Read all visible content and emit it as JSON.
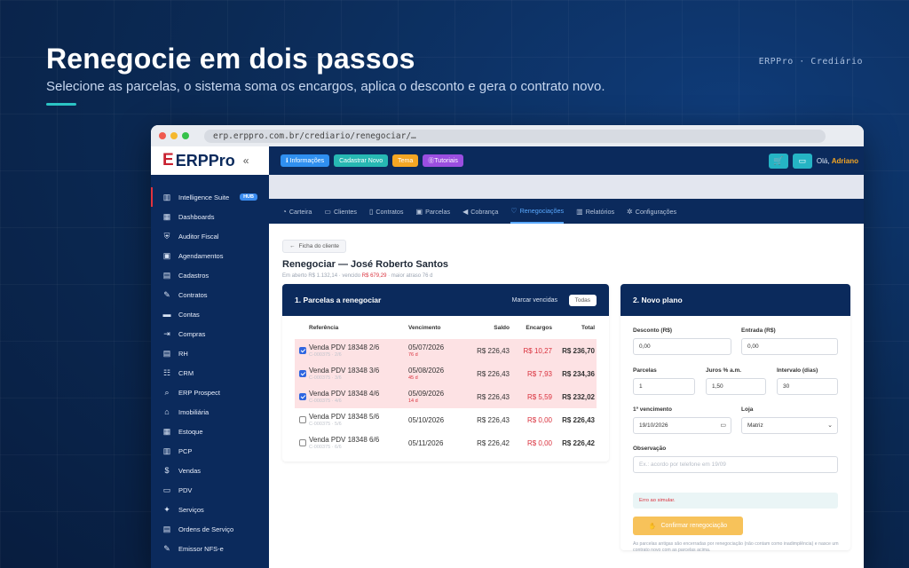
{
  "hero": {
    "title": "Renegocie em dois passos",
    "subtitle": "Selecione as parcelas, o sistema soma os encargos, aplica o desconto e gera o contrato novo.",
    "brand_tag": "ERPPro · Crediário"
  },
  "browser": {
    "url": "erp.erppro.com.br/crediario/renegociar/…"
  },
  "logo": {
    "mark": "E",
    "text": "ERPPro",
    "collapse_icon": "chevrons-left-icon"
  },
  "sidebar": {
    "items": [
      {
        "label": "Intelligence Suite",
        "icon": "chart-icon",
        "badge": "HUB"
      },
      {
        "label": "Dashboards",
        "icon": "dashboard-icon"
      },
      {
        "label": "Auditor Fiscal",
        "icon": "shield-icon"
      },
      {
        "label": "Agendamentos",
        "icon": "calendar-icon"
      },
      {
        "label": "Cadastros",
        "icon": "folder-icon"
      },
      {
        "label": "Contratos",
        "icon": "pen-icon"
      },
      {
        "label": "Contas",
        "icon": "wallet-icon"
      },
      {
        "label": "Compras",
        "icon": "login-icon"
      },
      {
        "label": "RH",
        "icon": "id-card-icon"
      },
      {
        "label": "CRM",
        "icon": "users-icon"
      },
      {
        "label": "ERP Prospect",
        "icon": "search-icon"
      },
      {
        "label": "Imobiliária",
        "icon": "home-icon"
      },
      {
        "label": "Estoque",
        "icon": "box-icon"
      },
      {
        "label": "PCP",
        "icon": "factory-icon"
      },
      {
        "label": "Vendas",
        "icon": "dollar-icon"
      },
      {
        "label": "PDV",
        "icon": "monitor-icon"
      },
      {
        "label": "Serviços",
        "icon": "wrench-icon"
      },
      {
        "label": "Ordens de Serviço",
        "icon": "clipboard-icon"
      },
      {
        "label": "Emissor NFS-e",
        "icon": "receipt-icon"
      }
    ]
  },
  "topbar": {
    "buttons": [
      {
        "label": "ℹ Informações",
        "color": "#2f8ff0"
      },
      {
        "label": "Cadastrar Novo",
        "color": "#27b8b3"
      },
      {
        "label": "Tema",
        "color": "#f5a623"
      },
      {
        "label": "⓪Tutoriais",
        "color": "#9b4ee0"
      }
    ],
    "greeting": "Olá,",
    "user": "Adriano"
  },
  "tabs": [
    {
      "label": "Carteira",
      "icon": "clock-icon"
    },
    {
      "label": "Clientes",
      "icon": "id-icon"
    },
    {
      "label": "Contratos",
      "icon": "document-icon"
    },
    {
      "label": "Parcelas",
      "icon": "calendar-icon"
    },
    {
      "label": "Cobrança",
      "icon": "megaphone-icon"
    },
    {
      "label": "Renegociações",
      "icon": "handshake-icon",
      "active": true
    },
    {
      "label": "Relatórios",
      "icon": "bar-chart-icon"
    },
    {
      "label": "Configurações",
      "icon": "gear-icon"
    }
  ],
  "page": {
    "back_label": "Ficha do cliente",
    "title": "Renegociar — José Roberto Santos",
    "sub_open": "Em aberto R$ 1.132,14 · vencido",
    "sub_overdue": "R$ 679,29",
    "sub_delay": "· maior atraso 76 d"
  },
  "parcelas": {
    "title": "1. Parcelas a renegociar",
    "mark_label": "Marcar vencidas",
    "all_label": "Todas",
    "headers": [
      "Referência",
      "Vencimento",
      "Saldo",
      "Encargos",
      "Total"
    ],
    "rows": [
      {
        "ref": "Venda PDV 18348 2/6",
        "code": "C-000375 · 2/6",
        "due": "05/07/2026",
        "delay": "76 d",
        "balance": "R$ 226,43",
        "charges": "R$ 10,27",
        "total": "R$ 236,70",
        "selected": true
      },
      {
        "ref": "Venda PDV 18348 3/6",
        "code": "C-000375 · 3/6",
        "due": "05/08/2026",
        "delay": "45 d",
        "balance": "R$ 226,43",
        "charges": "R$ 7,93",
        "total": "R$ 234,36",
        "selected": true
      },
      {
        "ref": "Venda PDV 18348 4/6",
        "code": "C-000375 · 4/6",
        "due": "05/09/2026",
        "delay": "14 d",
        "balance": "R$ 226,43",
        "charges": "R$ 5,59",
        "total": "R$ 232,02",
        "selected": true
      },
      {
        "ref": "Venda PDV 18348 5/6",
        "code": "C-000375 · 5/6",
        "due": "05/10/2026",
        "delay": "",
        "balance": "R$ 226,43",
        "charges": "R$ 0,00",
        "total": "R$ 226,43",
        "selected": false
      },
      {
        "ref": "Venda PDV 18348 6/6",
        "code": "C-000375 · 6/6",
        "due": "05/11/2026",
        "delay": "",
        "balance": "R$ 226,42",
        "charges": "R$ 0,00",
        "total": "R$ 226,42",
        "selected": false
      }
    ]
  },
  "plano": {
    "title": "2. Novo plano",
    "desconto_label": "Desconto (R$)",
    "desconto_value": "0,00",
    "entrada_label": "Entrada (R$)",
    "entrada_value": "0,00",
    "parcelas_label": "Parcelas",
    "parcelas_value": "1",
    "juros_label": "Juros % a.m.",
    "juros_value": "1,50",
    "intervalo_label": "Intervalo (dias)",
    "intervalo_value": "30",
    "venc_label": "1º vencimento",
    "venc_value": "19/10/2026",
    "loja_label": "Loja",
    "loja_value": "Matriz",
    "obs_label": "Observação",
    "obs_placeholder": "Ex.: acordo por telefone em 19/09",
    "error": "Erro ao simular.",
    "confirm_label": "Confirmar renegociação",
    "note": "As parcelas antigas são encerradas por renegociação (não contam como inadimplência) e nasce um contrato novo com as parcelas acima."
  }
}
